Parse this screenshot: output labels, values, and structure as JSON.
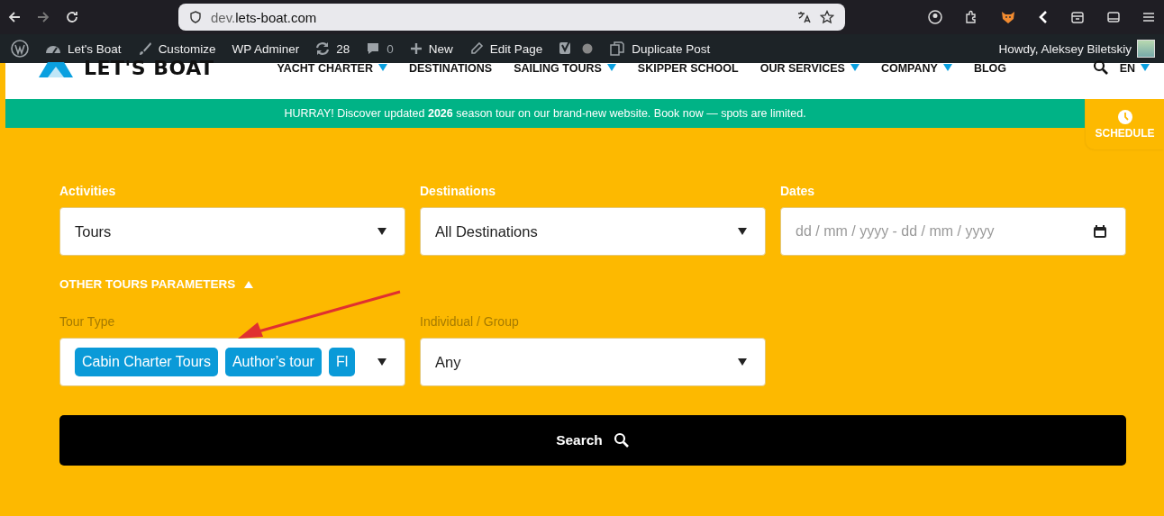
{
  "browser": {
    "url_host": "dev.",
    "url_domain": "lets-boat.com"
  },
  "admin_bar": {
    "items": [
      {
        "kind": "site",
        "label": "Let's Boat"
      },
      {
        "kind": "customize",
        "label": "Customize"
      },
      {
        "kind": "plain",
        "label": "WP Adminer"
      },
      {
        "kind": "updates",
        "label": "28"
      },
      {
        "kind": "comments",
        "label": "0"
      },
      {
        "kind": "new",
        "label": "New"
      },
      {
        "kind": "edit",
        "label": "Edit Page"
      },
      {
        "kind": "yoast"
      },
      {
        "kind": "duplicate",
        "label": "Duplicate Post"
      }
    ],
    "greeting": "Howdy, Aleksey Biletskiy"
  },
  "header": {
    "logo": "LET'S BOAT",
    "nav": [
      {
        "label": "YACHT CHARTER",
        "dropdown": true
      },
      {
        "label": "DESTINATIONS",
        "dropdown": false
      },
      {
        "label": "SAILING TOURS",
        "dropdown": true
      },
      {
        "label": "SKIPPER SCHOOL",
        "dropdown": false
      },
      {
        "label": "OUR SERVICES",
        "dropdown": true
      },
      {
        "label": "COMPANY",
        "dropdown": true
      },
      {
        "label": "BLOG",
        "dropdown": false
      }
    ],
    "language": "EN"
  },
  "banner": {
    "text": "HURRAY! Discover updated **2026** season tour on our brand-new website. Book now — spots are limited."
  },
  "schedule": {
    "label": "SCHEDULE"
  },
  "filters": [
    {
      "label": "Activities",
      "kind": "select",
      "value": "Tours"
    },
    {
      "label": "Destinations",
      "kind": "select",
      "value": "All Destinations"
    },
    {
      "label": "Dates",
      "kind": "date",
      "placeholder": "dd / mm / yyyy - dd / mm / yyyy"
    }
  ],
  "other_params": {
    "label": "OTHER TOURS PARAMETERS",
    "expanded": true
  },
  "extra_filters": [
    {
      "label": "Tour Type",
      "kind": "tags",
      "tags": [
        "Cabin Charter Tours",
        "Author’s tour",
        "Fl"
      ]
    },
    {
      "label": "Individual / Group",
      "kind": "select",
      "value": "Any"
    }
  ],
  "search_button": {
    "label": "Search"
  }
}
